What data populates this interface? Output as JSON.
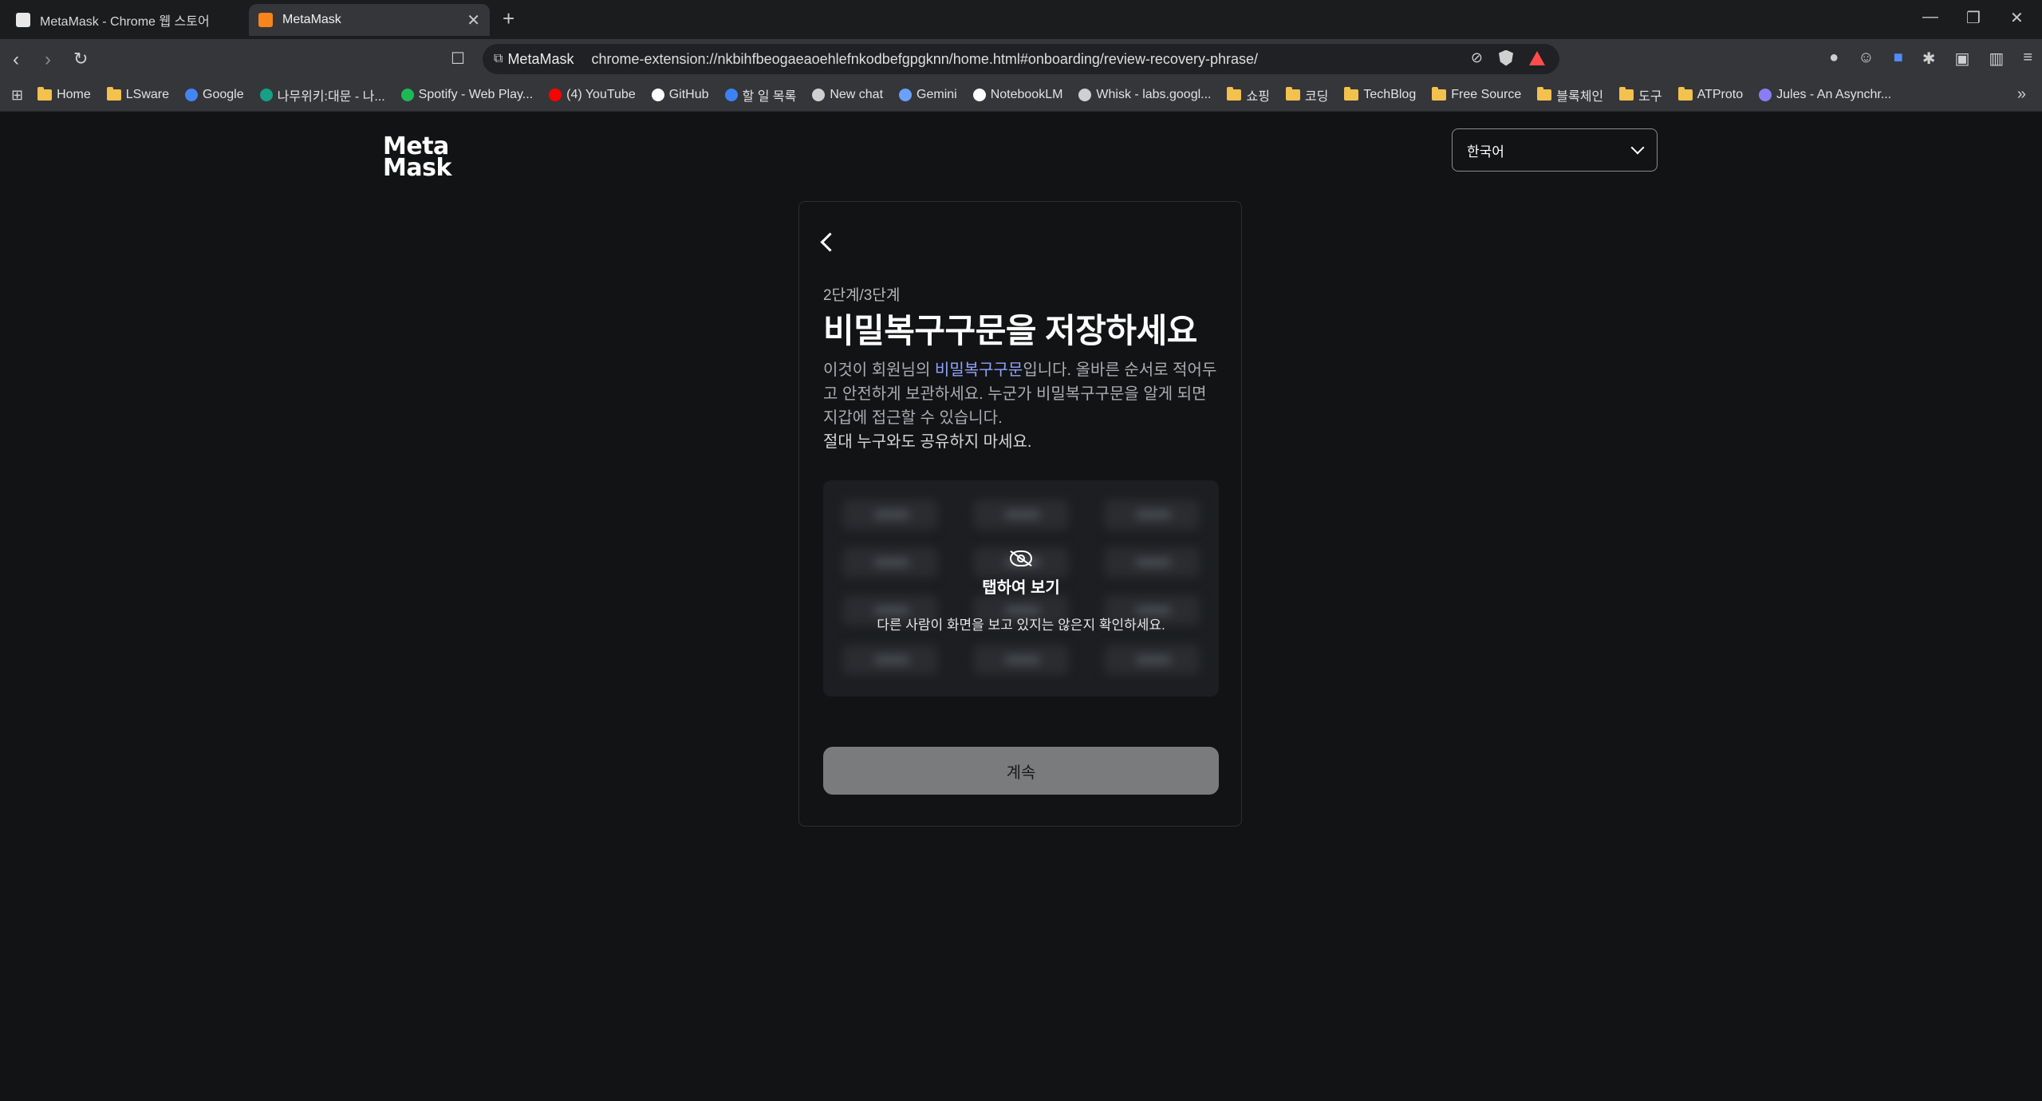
{
  "browser": {
    "tabs": [
      {
        "title": "MetaMask - Chrome 웹 스토어",
        "active": false
      },
      {
        "title": "MetaMask",
        "active": true
      }
    ],
    "site_chip": "MetaMask",
    "url": "chrome-extension://nkbihfbeogaeaoehlefnkodbefgpgknn/home.html#onboarding/review-recovery-phrase/",
    "bookmarks": [
      {
        "label": "Home",
        "icon": "folder-icon"
      },
      {
        "label": "LSware",
        "icon": "folder-icon"
      },
      {
        "label": "Google",
        "icon": "google-icon"
      },
      {
        "label": "나무위키:대문 - 나...",
        "icon": "namuwiki-icon"
      },
      {
        "label": "Spotify - Web Play...",
        "icon": "spotify-icon"
      },
      {
        "label": "(4) YouTube",
        "icon": "youtube-icon"
      },
      {
        "label": "GitHub",
        "icon": "github-icon"
      },
      {
        "label": "할 일 목록",
        "icon": "todo-icon"
      },
      {
        "label": "New chat",
        "icon": "chatgpt-icon"
      },
      {
        "label": "Gemini",
        "icon": "gemini-icon"
      },
      {
        "label": "NotebookLM",
        "icon": "notebooklm-icon"
      },
      {
        "label": "Whisk - labs.googl...",
        "icon": "flask-icon"
      },
      {
        "label": "쇼핑",
        "icon": "folder-icon"
      },
      {
        "label": "코딩",
        "icon": "folder-icon"
      },
      {
        "label": "TechBlog",
        "icon": "folder-icon"
      },
      {
        "label": "Free Source",
        "icon": "folder-icon"
      },
      {
        "label": "블록체인",
        "icon": "folder-icon"
      },
      {
        "label": "도구",
        "icon": "folder-icon"
      },
      {
        "label": "ATProto",
        "icon": "folder-icon"
      },
      {
        "label": "Jules - An Asynchr...",
        "icon": "jules-icon"
      }
    ]
  },
  "page": {
    "logo": {
      "line1": "Meta",
      "line2": "Mask"
    },
    "language": "한국어",
    "step": "2단계/3단계",
    "title": "비밀복구구문을 저장하세요",
    "desc_before": "이것이 회원님의 ",
    "desc_link": "비밀복구구문",
    "desc_after": "입니다. 올바른 순서로 적어두고 안전하게 보관하세요. 누군가 비밀복구구문을 알게 되면 지갑에 접근할 수 있습니다.",
    "desc_strong": "절대 누구와도 공유하지 마세요.",
    "reveal_title": "탭하여 보기",
    "reveal_sub": "다른 사람이 화면을 보고 있지는 않은지 확인하세요.",
    "continue_label": "계속"
  },
  "colors": {
    "background": "#121314",
    "link": "#8fa3ff",
    "button_disabled": "#7a7b7d"
  }
}
